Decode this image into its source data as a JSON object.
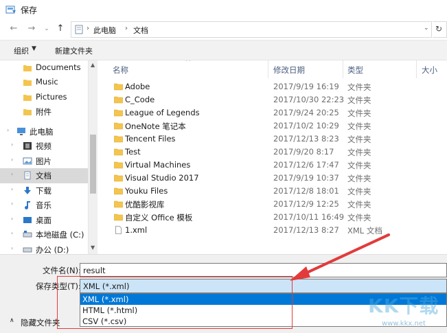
{
  "window": {
    "title": "保存"
  },
  "address": {
    "crumbs": [
      "此电脑",
      "文档"
    ]
  },
  "toolbar": {
    "organize": "组织",
    "new_folder": "新建文件夹"
  },
  "nav": {
    "items": [
      {
        "label": "Documents",
        "icon": "folder-icon"
      },
      {
        "label": "Music",
        "icon": "folder-icon"
      },
      {
        "label": "Pictures",
        "icon": "folder-icon"
      },
      {
        "label": "附件",
        "icon": "folder-icon"
      },
      {
        "label": "此电脑",
        "icon": "computer-icon"
      },
      {
        "label": "视频",
        "icon": "video-icon"
      },
      {
        "label": "图片",
        "icon": "picture-icon"
      },
      {
        "label": "文档",
        "icon": "document-icon"
      },
      {
        "label": "下载",
        "icon": "download-icon"
      },
      {
        "label": "音乐",
        "icon": "music-icon"
      },
      {
        "label": "桌面",
        "icon": "desktop-icon"
      },
      {
        "label": "本地磁盘 (C:)",
        "icon": "drive-icon"
      },
      {
        "label": "办公 (D:)",
        "icon": "drive-icon"
      }
    ],
    "selected": "文档"
  },
  "columns": {
    "name": "名称",
    "modified": "修改日期",
    "type": "类型",
    "size": "大小"
  },
  "files": [
    {
      "name": "Adobe",
      "date": "2017/9/19 16:19",
      "type": "文件夹",
      "icon": "folder-icon"
    },
    {
      "name": "C_Code",
      "date": "2017/10/30 22:23",
      "type": "文件夹",
      "icon": "folder-icon"
    },
    {
      "name": "League of Legends",
      "date": "2017/9/24 20:25",
      "type": "文件夹",
      "icon": "folder-icon"
    },
    {
      "name": "OneNote 笔记本",
      "date": "2017/10/2 10:29",
      "type": "文件夹",
      "icon": "folder-icon"
    },
    {
      "name": "Tencent Files",
      "date": "2017/12/13 8:23",
      "type": "文件夹",
      "icon": "folder-icon"
    },
    {
      "name": "Test",
      "date": "2017/9/20 8:17",
      "type": "文件夹",
      "icon": "folder-icon"
    },
    {
      "name": "Virtual Machines",
      "date": "2017/12/6 17:47",
      "type": "文件夹",
      "icon": "folder-icon"
    },
    {
      "name": "Visual Studio 2017",
      "date": "2017/9/19 10:37",
      "type": "文件夹",
      "icon": "folder-icon"
    },
    {
      "name": "Youku Files",
      "date": "2017/12/8 18:01",
      "type": "文件夹",
      "icon": "folder-icon"
    },
    {
      "name": "优酷影视库",
      "date": "2017/12/9 12:25",
      "type": "文件夹",
      "icon": "folder-icon"
    },
    {
      "name": "自定义 Office 模板",
      "date": "2017/10/11 16:49",
      "type": "文件夹",
      "icon": "folder-icon"
    },
    {
      "name": "1.xml",
      "date": "2017/12/13 8:27",
      "type": "XML 文档",
      "icon": "file-icon"
    }
  ],
  "form": {
    "filename_label": "文件名(N):",
    "filename_value": "result",
    "savetype_label": "保存类型(T):",
    "savetype_value": "XML (*.xml)",
    "options": [
      "XML (*.xml)",
      "HTML (*.html)",
      "CSV (*.csv)"
    ],
    "hide_folders": "隐藏文件夹"
  },
  "watermark": {
    "text": "KK下载",
    "url": "www.kkx.net"
  },
  "colors": {
    "accent": "#0078d7",
    "select_bg": "#cce4f7",
    "annotation": "#e23b3b",
    "folder": "#f4c54e"
  }
}
